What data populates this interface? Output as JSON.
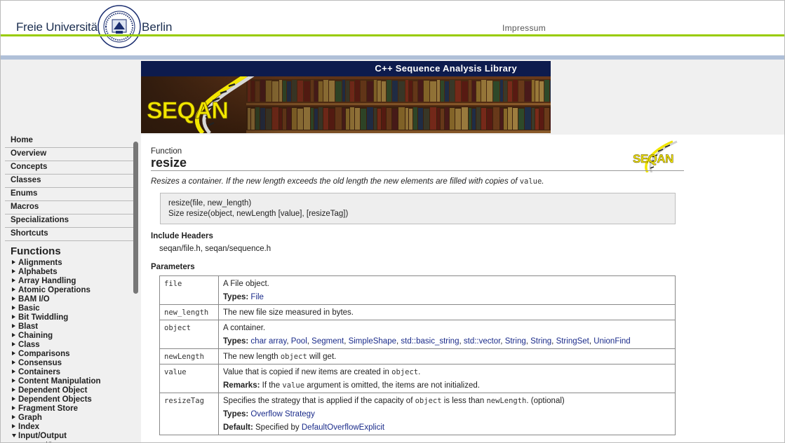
{
  "header": {
    "university_left": "Freie Universität",
    "university_right": "Berlin",
    "seal_text": "VERITAS IUSTITIA LIBERTAS · FREIE UNIVERSITÄT BERLIN",
    "impressum": "Impressum"
  },
  "banner": {
    "tagline": "C++ Sequence Analysis Library",
    "logo_text": "SEQAN"
  },
  "sidebar": {
    "nav": [
      "Home",
      "Overview",
      "Concepts",
      "Classes",
      "Enums",
      "Macros",
      "Specializations",
      "Shortcuts"
    ],
    "functions_heading": "Functions",
    "groups": [
      "Alignments",
      "Alphabets",
      "Array Handling",
      "Atomic Operations",
      "BAM I/O",
      "Basic",
      "Bit Twiddling",
      "Blast",
      "Chaining",
      "Class",
      "Comparisons",
      "Consensus",
      "Containers",
      "Content Manipulation",
      "Dependent Object",
      "Dependent Objects",
      "Fragment Store",
      "Graph",
      "Index"
    ],
    "expanded_group": "Input/Output",
    "sub_item": "appendSeqs"
  },
  "content": {
    "kind": "Function",
    "title": "resize",
    "summary_text": "Resizes a container. If the new length exceeds the old length the new elements are filled with copies of",
    "summary_code": "value",
    "summary_end": ".",
    "signatures": [
      "resize(file, new_length)",
      "Size resize(object, newLength [value], [resizeTag])"
    ],
    "include_heading": "Include Headers",
    "include_files": "seqan/file.h, seqan/sequence.h",
    "params_heading": "Parameters",
    "types_label": "Types:",
    "remarks_label": "Remarks:",
    "default_label": "Default:",
    "params": [
      {
        "name": "file",
        "desc": "A File object.",
        "types": [
          "File"
        ]
      },
      {
        "name": "new_length",
        "desc": "The new file size measured in bytes."
      },
      {
        "name": "object",
        "desc": "A container.",
        "types": [
          "char array",
          "Pool",
          "Segment",
          "SimpleShape",
          "std::basic_string",
          "std::vector",
          "String",
          "String",
          "StringSet",
          "UnionFind"
        ]
      },
      {
        "name": "newLength",
        "desc_pre": "The new length",
        "desc_code": "object",
        "desc_post": "will get."
      },
      {
        "name": "value",
        "desc_pre": "Value that is copied if new items are created in",
        "desc_code": "object",
        "desc_post": ".",
        "remarks_pre": "If the",
        "remarks_code": "value",
        "remarks_post": "argument is omitted, the items are not initialized."
      },
      {
        "name": "resizeTag",
        "desc_pre": "Specifies the strategy that is applied if the capacity of",
        "desc_code": "object",
        "desc_mid": "is less than",
        "desc_code2": "newLength",
        "desc_post": ". (optional)",
        "types": [
          "Overflow Strategy"
        ],
        "default_pre": "Specified by",
        "default_link": "DefaultOverflowExplicit"
      }
    ]
  },
  "colors": {
    "fu_green": "#99cc00",
    "fu_blue_rule": "#b0c0d8",
    "banner_navy": "#0d1b4d",
    "link": "#1a2b8a",
    "seqan_yellow": "#f2e600"
  }
}
